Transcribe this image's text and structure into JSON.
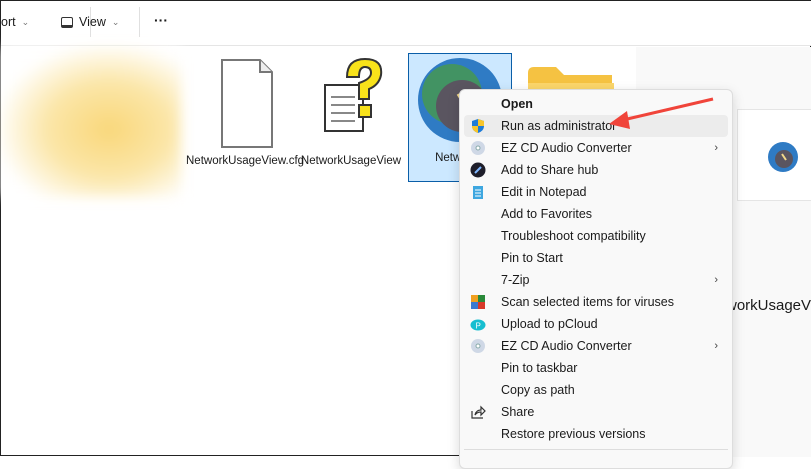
{
  "toolbar": {
    "sort_label": "ort",
    "view_label": "View",
    "more_label": "···"
  },
  "files": [
    {
      "name": "NetworkUsageView.cfg"
    },
    {
      "name": "NetworkUsageView"
    },
    {
      "name": "NetworkUsageView.exe",
      "partial": "Network e"
    }
  ],
  "details": {
    "title": "workUsageVi"
  },
  "menu": {
    "items": [
      {
        "label": "Open",
        "icon": "none",
        "bold": true
      },
      {
        "label": "Run as administrator",
        "icon": "uac-shield-icon",
        "highlight": true
      },
      {
        "label": "EZ CD Audio Converter",
        "icon": "cd-icon",
        "submenu": true
      },
      {
        "label": "Add to Share hub",
        "icon": "share-hub-icon"
      },
      {
        "label": "Edit in Notepad",
        "icon": "notepad-icon"
      },
      {
        "label": "Add to Favorites"
      },
      {
        "label": "Troubleshoot compatibility"
      },
      {
        "label": "Pin to Start"
      },
      {
        "label": "7-Zip",
        "submenu": true
      },
      {
        "label": "Scan selected items for viruses",
        "icon": "avg-icon"
      },
      {
        "label": "Upload to pCloud",
        "icon": "pcloud-icon"
      },
      {
        "label": "EZ CD Audio Converter",
        "icon": "cd-icon",
        "submenu": true
      },
      {
        "label": "Pin to taskbar"
      },
      {
        "label": "Copy as path"
      },
      {
        "label": "Share",
        "icon": "share-icon"
      },
      {
        "label": "Restore previous versions"
      }
    ]
  },
  "colors": {
    "arrow": "#f0443a",
    "selection": "#cce8ff"
  }
}
